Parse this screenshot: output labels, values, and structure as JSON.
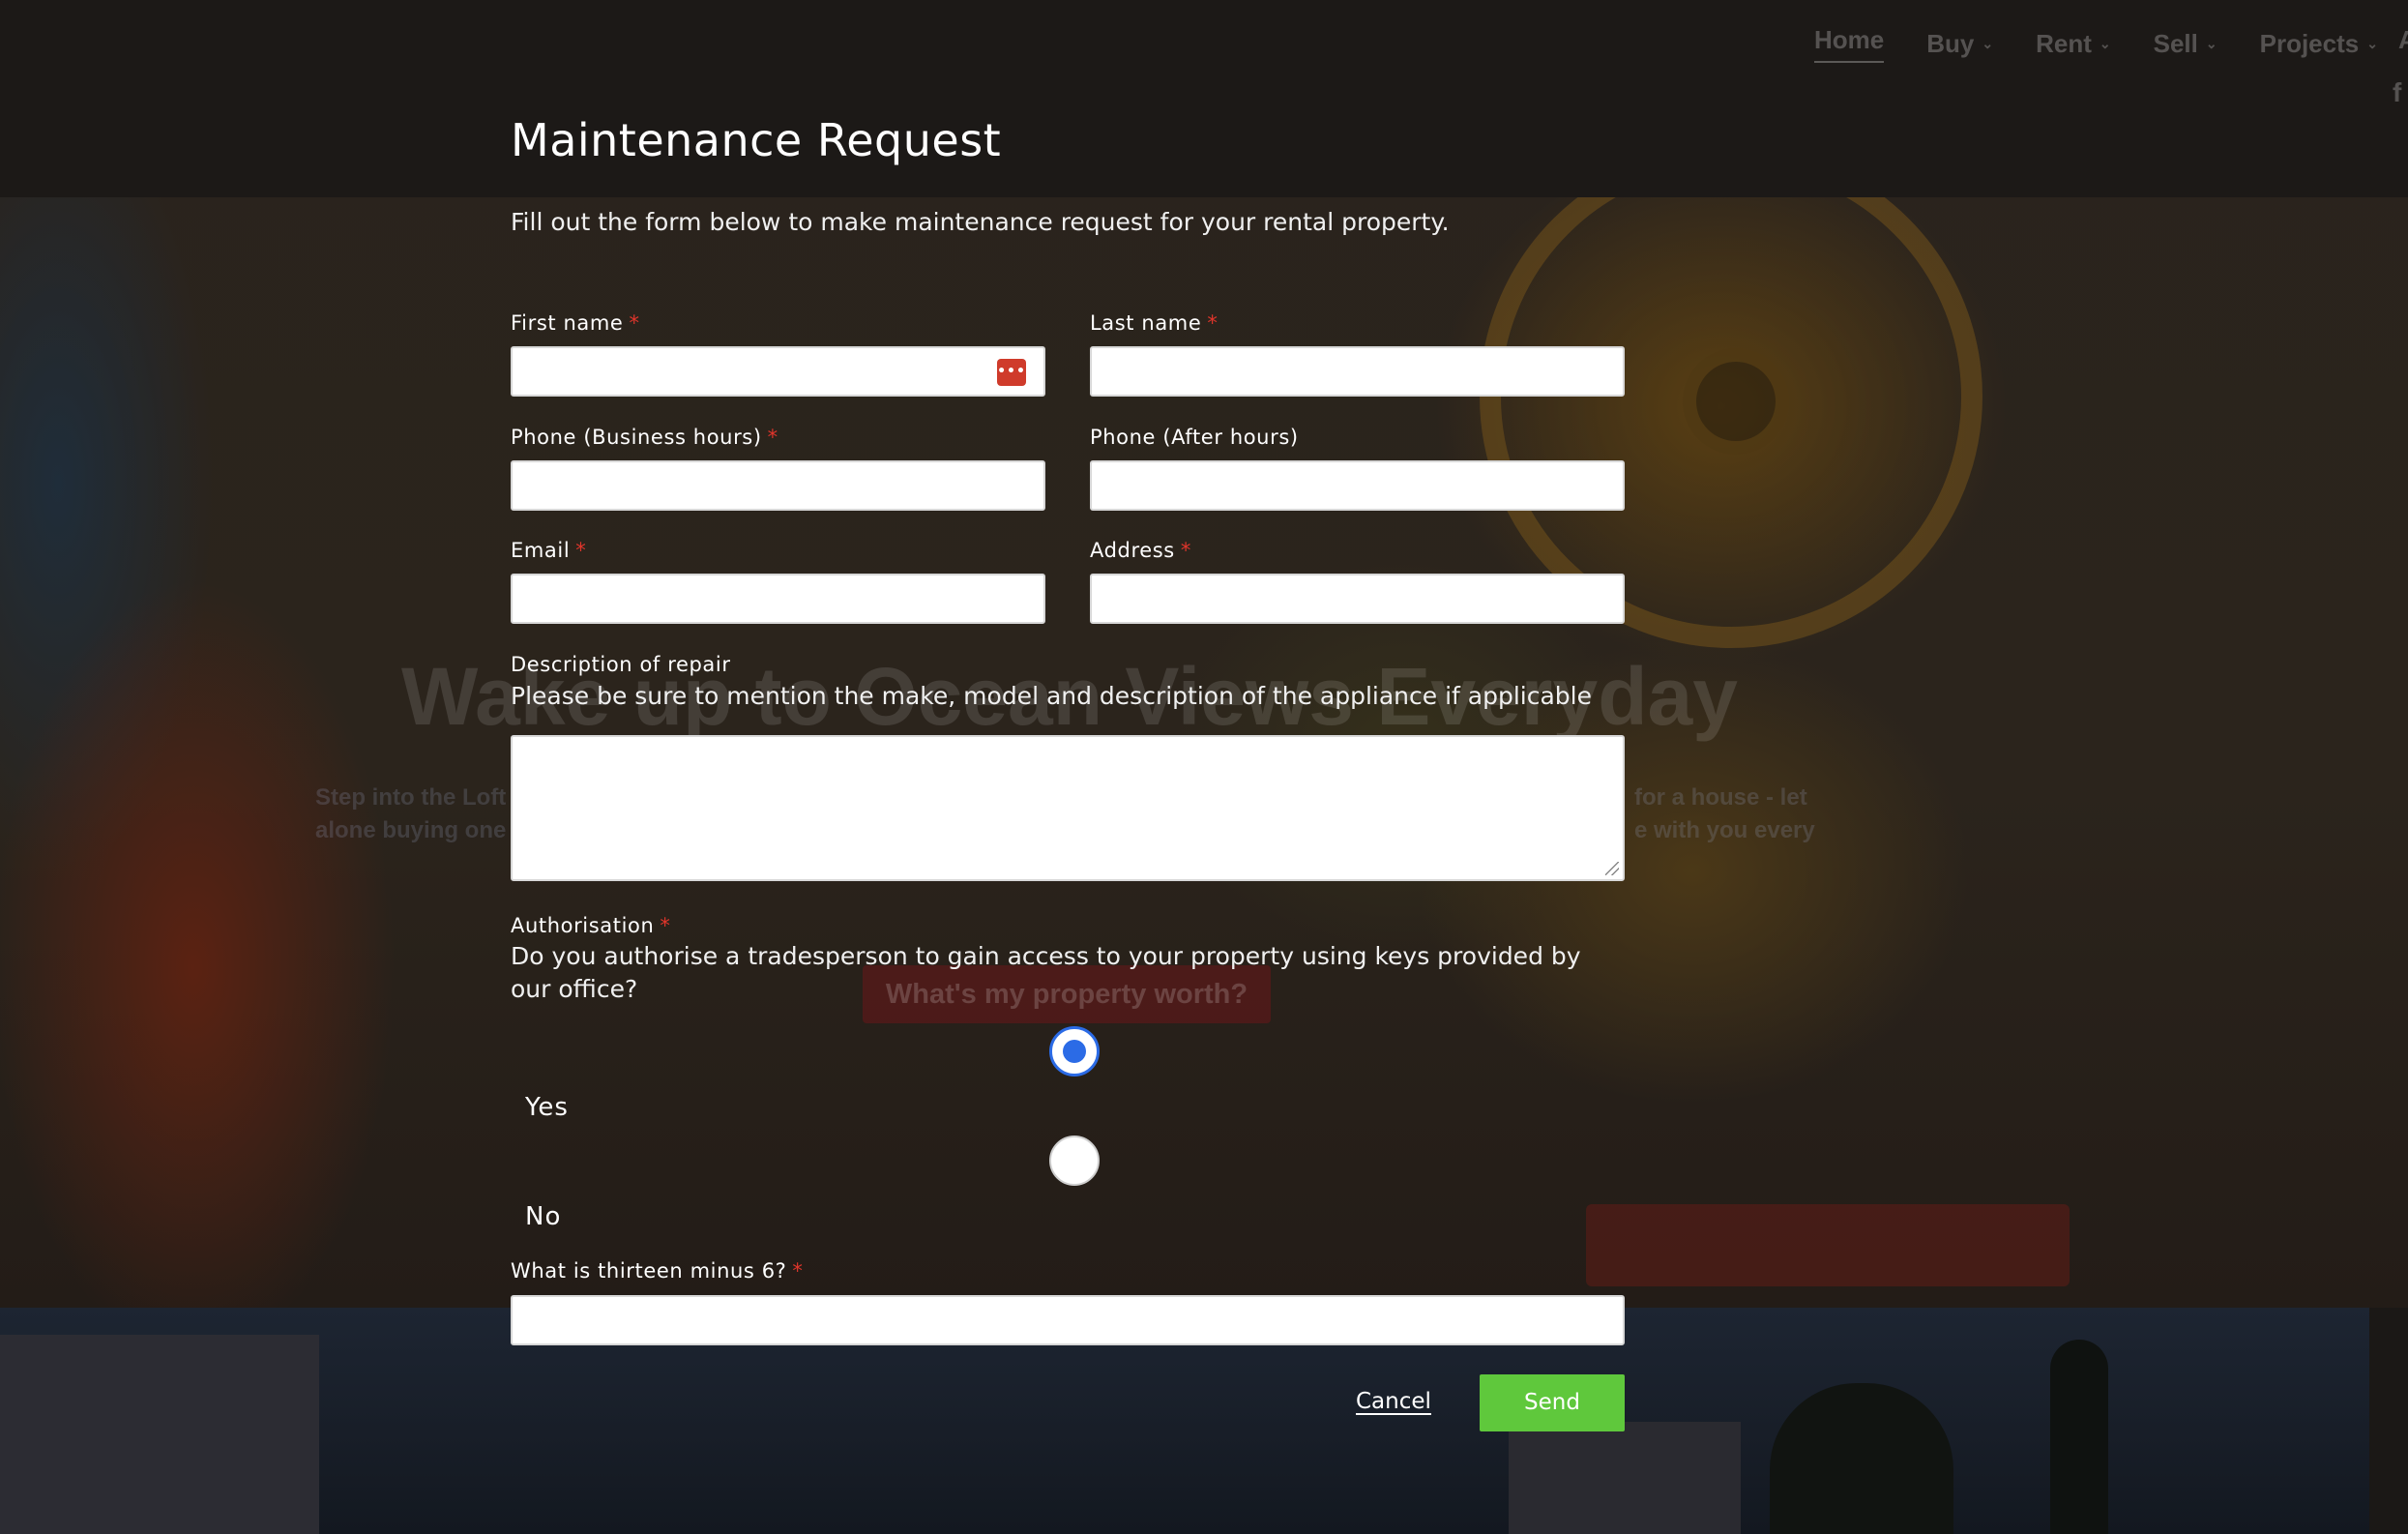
{
  "nav": {
    "items": [
      {
        "label": "Home",
        "active": true,
        "has_dropdown": false
      },
      {
        "label": "Buy",
        "active": false,
        "has_dropdown": true
      },
      {
        "label": "Rent",
        "active": false,
        "has_dropdown": true
      },
      {
        "label": "Sell",
        "active": false,
        "has_dropdown": true
      },
      {
        "label": "Projects",
        "active": false,
        "has_dropdown": true
      }
    ],
    "overflow_text": "A",
    "facebook_icon": "facebook-icon",
    "facebook_glyph": "f",
    "caret_glyph": "⌄"
  },
  "hero": {
    "headline": "Wake up to Ocean Views Everyday",
    "text_left_line1": "Step into the Loft",
    "text_left_line2": "alone buying one",
    "text_right_line1": "for a house - let",
    "text_right_line2": "e with you every",
    "cta_label": "What's my property worth?"
  },
  "form": {
    "title": "Maintenance Request",
    "intro": "Fill out the form below to make maintenance request for your rental property.",
    "required_marker": "*",
    "fields": {
      "first_name": {
        "label": "First name",
        "required": true,
        "value": "",
        "icon": "password-manager-icon",
        "icon_glyph": "•••"
      },
      "last_name": {
        "label": "Last name",
        "required": true,
        "value": ""
      },
      "phone_business": {
        "label": "Phone (Business hours)",
        "required": true,
        "value": ""
      },
      "phone_after": {
        "label": "Phone (After hours)",
        "required": false,
        "value": ""
      },
      "email": {
        "label": "Email",
        "required": true,
        "value": ""
      },
      "address": {
        "label": "Address",
        "required": true,
        "value": ""
      },
      "description": {
        "label": "Description of repair",
        "hint": "Please be sure to mention the make, model and description of the appliance if applicable",
        "value": ""
      },
      "authorisation": {
        "label": "Authorisation",
        "required": true,
        "question": "Do you authorise a tradesperson to gain access to your property using keys provided by our office?",
        "options": [
          {
            "label": "Yes",
            "checked": true
          },
          {
            "label": "No",
            "checked": false
          }
        ]
      },
      "captcha": {
        "label": "What is thirteen minus 6?",
        "required": true,
        "value": ""
      }
    },
    "actions": {
      "cancel": "Cancel",
      "send": "Send"
    },
    "colors": {
      "accent_send": "#5fc83c",
      "required": "#e0352b",
      "radio_selected": "#2b6be6"
    }
  }
}
